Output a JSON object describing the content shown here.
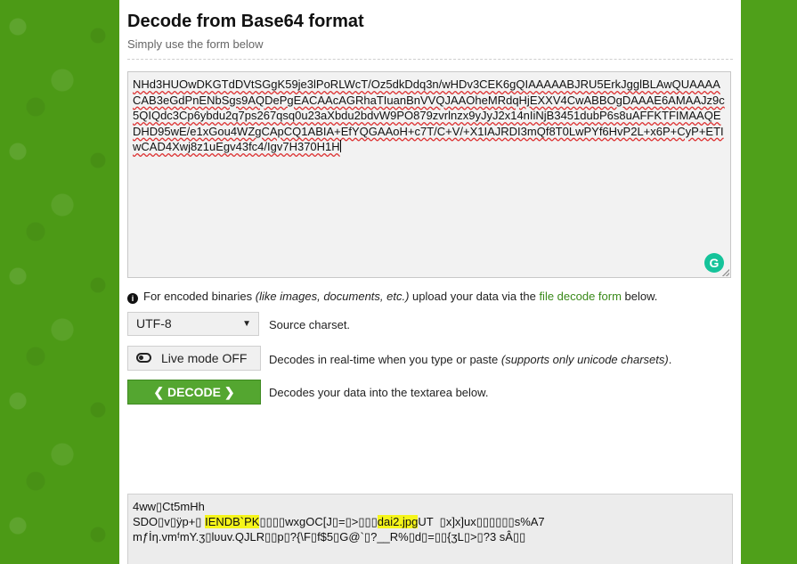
{
  "page": {
    "title": "Decode from Base64 format",
    "subtitle": "Simply use the form below"
  },
  "input": {
    "text": "NHd3HUOwDKGTdDVtSGgK59je3lPoRLWcT/Oz5dkDdq3n/wHDv3CEK6gQIAAAAABJRU5ErkJgglBLAwQUAAAACAB3eGdPnENbSgs9AQDePgEACAAcAGRhaTIuanBnVVQJAAOheMRdqHjEXXV4CwABBOgDAAAE6AMAAJz9c5QIQdc3Cp6ybdu2q7ps267qsq0u23aXbdu2bdvW9PO879zvrlnzx9yJyJ2x14nIiNjB3451dubP6s8uAFFKTFIMAAQEDHD95wE/e1xGou4WZgCApCQ1ABIA+EfYQGAAoH+c7T/C+V/+X1IAJRDI3mQf8T0LwPYf6HvP2L+x6P+CyP+ETIwCAD4Xwj8z1uEgv43fc4/Igv7H370H1H",
    "grammarly_icon": "grammarly-icon"
  },
  "info": {
    "text_before": "For encoded binaries ",
    "italic": "(like images, documents, etc.)",
    "text_middle": " upload your data via the ",
    "link": "file decode form",
    "text_after": " below."
  },
  "charset": {
    "selected": "UTF-8",
    "label": "Source charset."
  },
  "live_mode": {
    "button": "Live mode OFF",
    "label": "Decodes in real-time when you type or paste ",
    "label_italic": "(supports only unicode charsets)",
    "label_end": "."
  },
  "decode": {
    "button": "DECODE",
    "label": "Decodes your data into the textarea below."
  },
  "output": {
    "line1": "4ww▯Ct5mHh",
    "line2_a": "SDO▯v▯ÿp+▯ ",
    "line2_hl1": "IENDB`PK",
    "line2_b": "▯▯▯▯wxgOC[J▯=▯>▯▯▯",
    "line2_hl2": "dai2.jpg",
    "line2_c": "UT  ▯x]x]ux▯▯▯▯▯▯s%A7",
    "line3": "mƒİƞ.vmᶠmY.ʒ▯lʋuv.QJLR▯▯p▯?{\\F▯f$5▯G@`▯?__R%▯d▯=▯▯{ʒL▯>▯?3 sÂ▯▯"
  }
}
